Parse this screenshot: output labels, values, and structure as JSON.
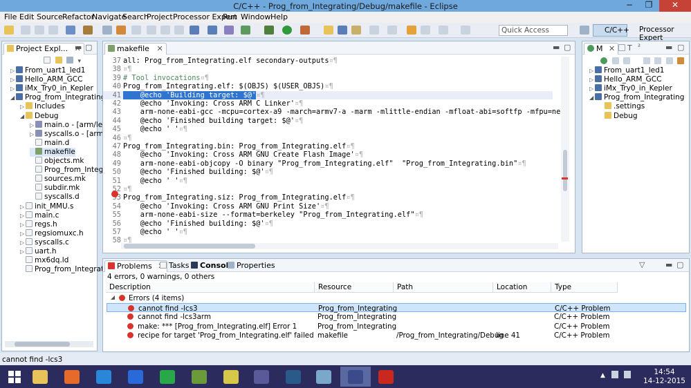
{
  "window": {
    "title": "C/C++ - Prog_from_Integrating/Debug/makefile - Eclipse",
    "minimize": "−",
    "maximize": "❐",
    "close": "✕"
  },
  "menu": [
    "File",
    "Edit",
    "Source",
    "Refactor",
    "Navigate",
    "Search",
    "Project",
    "Processor Expert",
    "Run",
    "Window",
    "Help"
  ],
  "toolbar": {
    "quick_access_placeholder": "Quick Access",
    "perspective_cpp": "C/C++",
    "perspective_pe": "Processor Expert"
  },
  "project_explorer": {
    "tab_label": "Project Expl...",
    "items": [
      {
        "label": "From_uart1_led1",
        "type": "proj",
        "indent": 0,
        "arrow": "▷"
      },
      {
        "label": "Hello_ARM_GCC",
        "type": "proj",
        "indent": 0,
        "arrow": "▷"
      },
      {
        "label": "iMx_Try0_in_Kepler",
        "type": "proj",
        "indent": 0,
        "arrow": "▷"
      },
      {
        "label": "Prog_from_Integrating",
        "type": "proj",
        "indent": 0,
        "arrow": "◢"
      },
      {
        "label": "Includes",
        "type": "folder",
        "indent": 1,
        "arrow": "▷"
      },
      {
        "label": "Debug",
        "type": "folder",
        "indent": 1,
        "arrow": "◢"
      },
      {
        "label": "main.o - [arm/le]",
        "type": "obj",
        "indent": 2,
        "arrow": "▷"
      },
      {
        "label": "syscalls.o - [arm/l",
        "type": "obj",
        "indent": 2,
        "arrow": "▷"
      },
      {
        "label": "main.d",
        "type": "file",
        "indent": 2,
        "arrow": ""
      },
      {
        "label": "makefile",
        "type": "mk",
        "indent": 2,
        "arrow": ""
      },
      {
        "label": "objects.mk",
        "type": "file",
        "indent": 2,
        "arrow": ""
      },
      {
        "label": "Prog_from_Integra",
        "type": "file",
        "indent": 2,
        "arrow": ""
      },
      {
        "label": "sources.mk",
        "type": "file",
        "indent": 2,
        "arrow": ""
      },
      {
        "label": "subdir.mk",
        "type": "file",
        "indent": 2,
        "arrow": ""
      },
      {
        "label": "syscalls.d",
        "type": "file",
        "indent": 2,
        "arrow": ""
      },
      {
        "label": "init_MMU.s",
        "type": "file",
        "indent": 1,
        "arrow": "▷"
      },
      {
        "label": "main.c",
        "type": "file",
        "indent": 1,
        "arrow": "▷"
      },
      {
        "label": "regs.h",
        "type": "file",
        "indent": 1,
        "arrow": "▷"
      },
      {
        "label": "regsiomuxc.h",
        "type": "file",
        "indent": 1,
        "arrow": "▷"
      },
      {
        "label": "syscalls.c",
        "type": "file",
        "indent": 1,
        "arrow": "▷"
      },
      {
        "label": "uart.h",
        "type": "file",
        "indent": 1,
        "arrow": "▷"
      },
      {
        "label": "mx6dq.ld",
        "type": "file",
        "indent": 1,
        "arrow": ""
      },
      {
        "label": "Prog_from_Integratin",
        "type": "file",
        "indent": 1,
        "arrow": ""
      }
    ]
  },
  "editor": {
    "tab_label": "makefile",
    "lines": [
      {
        "n": "37",
        "text": "all: Prog_from_Integrating.elf secondary-outputs",
        "ws": "¤¶",
        "kind": ""
      },
      {
        "n": "38",
        "text": "",
        "ws": "¤¶",
        "kind": ""
      },
      {
        "n": "39",
        "text": "# Tool invocations",
        "ws": "¤¶",
        "kind": "cmt"
      },
      {
        "n": "40",
        "text": "Prog_from_Integrating.elf: $(OBJS) $(USER_OBJS)",
        "ws": "¤¶",
        "kind": ""
      },
      {
        "n": "41",
        "text": "    @echo 'Building target: $@'",
        "ws": "¤¶",
        "kind": "hl"
      },
      {
        "n": "42",
        "text": "    @echo 'Invoking: Cross ARM C Linker'",
        "ws": "¤¶",
        "kind": ""
      },
      {
        "n": "43",
        "text": "    arm-none-eabi-gcc -mcpu=cortex-a9 -march=armv7-a -marm -mlittle-endian -mfloat-abi=softfp -mfpu=neon -mn",
        "ws": "",
        "kind": ""
      },
      {
        "n": "44",
        "text": "    @echo 'Finished building target: $@'",
        "ws": "¤¶",
        "kind": ""
      },
      {
        "n": "45",
        "text": "    @echo ' '",
        "ws": "¤¶",
        "kind": ""
      },
      {
        "n": "46",
        "text": "",
        "ws": "¤¶",
        "kind": ""
      },
      {
        "n": "47",
        "text": "Prog_from_Integrating.bin: Prog_from_Integrating.elf",
        "ws": "¤¶",
        "kind": ""
      },
      {
        "n": "48",
        "text": "    @echo 'Invoking: Cross ARM GNU Create Flash Image'",
        "ws": "¤¶",
        "kind": ""
      },
      {
        "n": "49",
        "text": "    arm-none-eabi-objcopy -O binary \"Prog_from_Integrating.elf\"  \"Prog_from_Integrating.bin\"",
        "ws": "¤¶",
        "kind": ""
      },
      {
        "n": "50",
        "text": "    @echo 'Finished building: $@'",
        "ws": "¤¶",
        "kind": ""
      },
      {
        "n": "51",
        "text": "    @echo ' '",
        "ws": "¤¶",
        "kind": ""
      },
      {
        "n": "52",
        "text": "",
        "ws": "¤¶",
        "kind": ""
      },
      {
        "n": "53",
        "text": "Prog_from_Integrating.siz: Prog_from_Integrating.elf",
        "ws": "¤¶",
        "kind": ""
      },
      {
        "n": "54",
        "text": "    @echo 'Invoking: Cross ARM GNU Print Size'",
        "ws": "¤¶",
        "kind": ""
      },
      {
        "n": "55",
        "text": "    arm-none-eabi-size --format=berkeley \"Prog_from_Integrating.elf\"",
        "ws": "¤¶",
        "kind": ""
      },
      {
        "n": "56",
        "text": "    @echo 'Finished building: $@'",
        "ws": "¤¶",
        "kind": ""
      },
      {
        "n": "57",
        "text": "    @echo ' '",
        "ws": "¤¶",
        "kind": ""
      },
      {
        "n": "58",
        "text": "",
        "ws": "¤¶",
        "kind": ""
      }
    ]
  },
  "outline": {
    "tab_m": "M",
    "tab_t": "T",
    "tab_num": "²",
    "items": [
      {
        "label": "From_uart1_led1",
        "type": "proj",
        "indent": 0,
        "arrow": "▷"
      },
      {
        "label": "Hello_ARM_GCC",
        "type": "proj",
        "indent": 0,
        "arrow": "▷"
      },
      {
        "label": "iMx_Try0_in_Kepler",
        "type": "proj",
        "indent": 0,
        "arrow": "▷"
      },
      {
        "label": "Prog_from_Integrating",
        "type": "proj",
        "indent": 0,
        "arrow": "◢"
      },
      {
        "label": ".settings",
        "type": "folder",
        "indent": 1,
        "arrow": ""
      },
      {
        "label": "Debug",
        "type": "folder",
        "indent": 1,
        "arrow": ""
      }
    ]
  },
  "problems": {
    "tabs": [
      "Problems",
      "Tasks",
      "Console",
      "Properties"
    ],
    "summary": "4 errors, 0 warnings, 0 others",
    "columns": [
      "Description",
      "Resource",
      "Path",
      "Location",
      "Type"
    ],
    "group_label": "Errors (4 items)",
    "rows": [
      {
        "description": "cannot find -lcs3",
        "resource": "Prog_from_Integrating",
        "path": "",
        "location": "",
        "type": "C/C++ Problem"
      },
      {
        "description": "cannot find -lcs3arm",
        "resource": "Prog_from_Integrating",
        "path": "",
        "location": "",
        "type": "C/C++ Problem"
      },
      {
        "description": "make: *** [Prog_from_Integrating.elf] Error 1",
        "resource": "Prog_from_Integrating",
        "path": "",
        "location": "",
        "type": "C/C++ Problem"
      },
      {
        "description": "recipe for target 'Prog_from_Integrating.elf' failed",
        "resource": "makefile",
        "path": "/Prog_from_Integrating/Debug",
        "location": "line 41",
        "type": "C/C++ Problem"
      }
    ]
  },
  "status": {
    "text": "cannot find -lcs3"
  },
  "taskbar": {
    "apps": [
      "start-icon",
      "file-explorer-icon",
      "firefox-icon",
      "internet-explorer-icon",
      "word-icon",
      "spreadsheet-icon",
      "notepad-icon",
      "folder-icon",
      "eclipse-icon",
      "ide-icon",
      "drawing-icon",
      "eclipse-active-icon",
      "acrobat-icon"
    ],
    "time": "14:54",
    "date": "14-12-2015"
  },
  "colors": {
    "titlebar": "#6fa8dc",
    "selection": "#2f74d0",
    "error": "#d9342b",
    "taskbar": "#2b2b5e"
  }
}
